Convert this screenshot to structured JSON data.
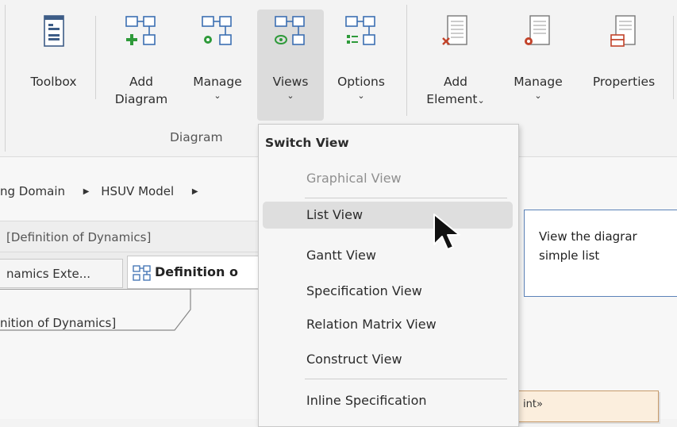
{
  "ribbon": {
    "toolbox_label": "Toolbox",
    "add_diagram_label_1": "Add",
    "add_diagram_label_2": "Diagram",
    "manage_diagram_label": "Manage",
    "views_label": "Views",
    "options_label": "Options",
    "add_element_label_1": "Add",
    "add_element_label_2": "Element",
    "manage_element_label": "Manage",
    "properties_label": "Properties",
    "diagram_group_label": "Diagram",
    "chevron_glyph": "⌄"
  },
  "breadcrumb": {
    "items": [
      "ng Domain",
      "HSUV Model"
    ]
  },
  "view": {
    "title": "[Definition of Dynamics]",
    "tabs": [
      "namics Exte...",
      "Definition o"
    ],
    "diagram_frame_title": "nition of Dynamics]"
  },
  "menu": {
    "header": "Switch View",
    "items": [
      {
        "label": "Graphical View",
        "disabled": true
      },
      {
        "label": "List View",
        "hover": true
      },
      {
        "label": "Gantt View"
      },
      {
        "label": "Specification View"
      },
      {
        "label": "Relation Matrix View"
      },
      {
        "label": "Construct View"
      },
      {
        "label": "Inline Specification"
      }
    ]
  },
  "tooltip": {
    "line1": "View the diagrar",
    "line2": "simple list"
  },
  "element": {
    "stereotype_fragment": "int»"
  },
  "colors": {
    "accent_blue": "#3c6fb2",
    "green": "#2e9a3a",
    "red": "#c2432a",
    "hover": "#dedede"
  }
}
